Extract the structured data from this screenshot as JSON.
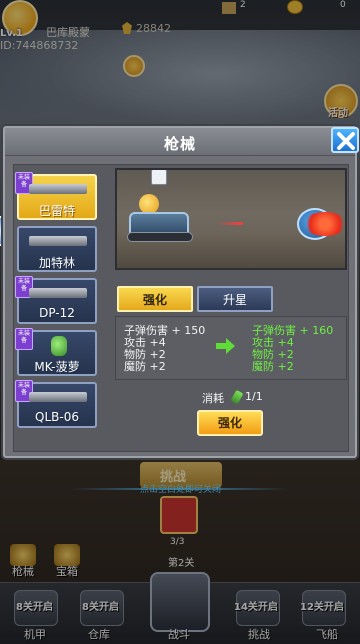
{
  "header": {
    "level": "Lv.1",
    "name": "巴库殿蒙",
    "player_id": "ID:744868732",
    "power": "28842",
    "fuel": "2",
    "coins": "0"
  },
  "background": {
    "activity_label": "活动",
    "battle_label": "挑战",
    "hint": "点击空白处即可关闭",
    "stage_progress": "3/3",
    "stage_name": "第2关",
    "side_menu": [
      {
        "label": "枪械",
        "icon": "gun-icon"
      },
      {
        "label": "宝箱",
        "icon": "chest-icon"
      }
    ],
    "bottom_nav": [
      {
        "label": "机甲",
        "lock": "8关开启"
      },
      {
        "label": "仓库",
        "lock": "8关开启"
      },
      {
        "label": "战斗",
        "lock": ""
      },
      {
        "label": "挑战",
        "lock": "14关开启"
      },
      {
        "label": "飞船",
        "lock": "12关开启"
      }
    ]
  },
  "modal": {
    "title": "枪械",
    "weapons": [
      {
        "name": "巴雷特",
        "badge": "未装备",
        "selected": true
      },
      {
        "name": "加特林",
        "badge": "",
        "selected": false
      },
      {
        "name": "DP-12",
        "badge": "未装备",
        "selected": false
      },
      {
        "name": "MK-菠萝",
        "badge": "未装备",
        "selected": false
      },
      {
        "name": "QLB-06",
        "badge": "未装备",
        "selected": false
      }
    ],
    "tabs": {
      "upgrade": "强化",
      "star": "升星"
    },
    "stats_current": [
      "子弹伤害 + 150",
      "攻击 +4",
      "物防 +2",
      "魔防 +2"
    ],
    "stats_next": [
      "子弹伤害 + 160",
      "攻击 +4",
      "物防 +2",
      "魔防 +2"
    ],
    "cost_label": "消耗",
    "cost_value": "1/1",
    "upgrade_button": "强化"
  },
  "colors": {
    "accent_yellow": "#f5c22d",
    "next_stat_green": "#6ff043",
    "close_blue": "#1c6fd1"
  }
}
